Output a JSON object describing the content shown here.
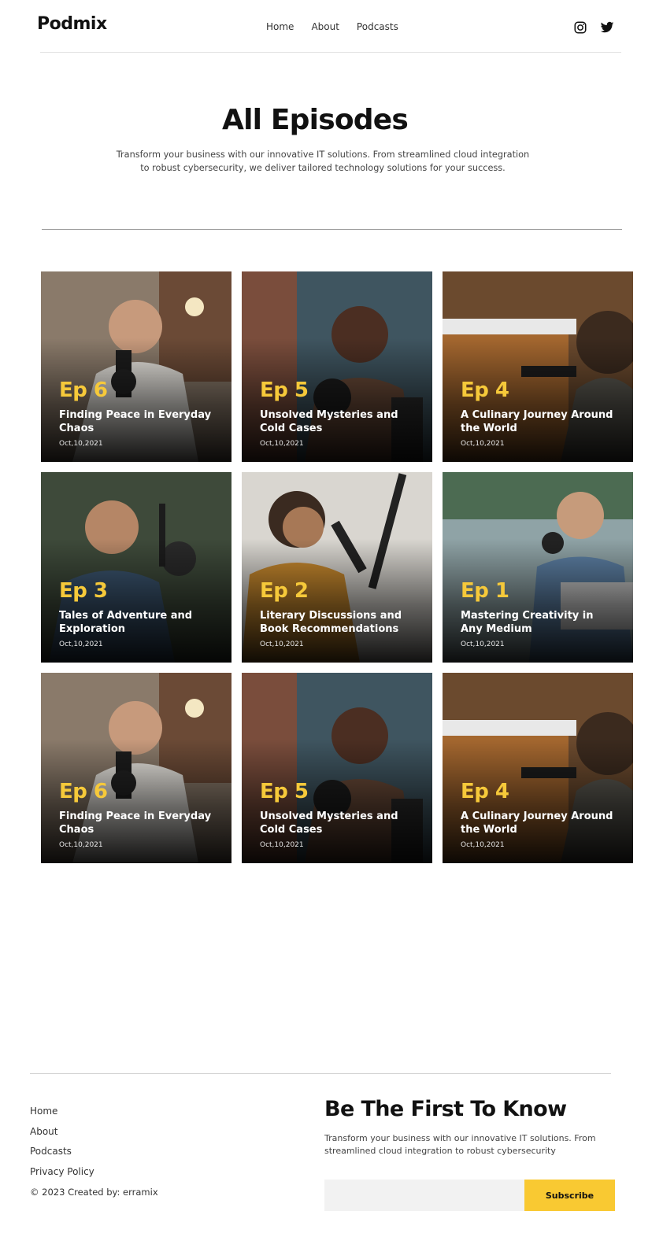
{
  "brand": {
    "name": "Podmix"
  },
  "nav": {
    "items": [
      "Home",
      "About",
      "Podcasts"
    ]
  },
  "social": {
    "icons": [
      "instagram-icon",
      "twitter-icon"
    ]
  },
  "hero": {
    "title": "All Episodes",
    "subtitle": "Transform your business with our innovative IT solutions. From streamlined cloud integration to robust cybersecurity, we deliver tailored technology solutions for your success."
  },
  "episodes": [
    {
      "ep": "Ep 6",
      "title": "Finding Peace in Everyday Chaos",
      "date": "Oct,10,2021"
    },
    {
      "ep": "Ep 5",
      "title": "Unsolved Mysteries and Cold Cases",
      "date": "Oct,10,2021"
    },
    {
      "ep": "Ep 4",
      "title": "A Culinary Journey Around the World",
      "date": "Oct,10,2021"
    },
    {
      "ep": "Ep 3",
      "title": "Tales of Adventure and Exploration",
      "date": "Oct,10,2021"
    },
    {
      "ep": "Ep 2",
      "title": "Literary Discussions and Book Recommendations",
      "date": "Oct,10,2021"
    },
    {
      "ep": "Ep 1",
      "title": "Mastering Creativity in Any Medium",
      "date": "Oct,10,2021"
    },
    {
      "ep": "Ep 6",
      "title": "Finding Peace in Everyday Chaos",
      "date": "Oct,10,2021"
    },
    {
      "ep": "Ep 5",
      "title": "Unsolved Mysteries and Cold Cases",
      "date": "Oct,10,2021"
    },
    {
      "ep": "Ep 4",
      "title": "A Culinary Journey Around the World",
      "date": "Oct,10,2021"
    }
  ],
  "footer": {
    "links": [
      "Home",
      "About",
      "Podcasts",
      "Privacy Policy"
    ],
    "copyright": "© 2023 Created by: erramix",
    "newsletter": {
      "title": "Be The First To Know",
      "text": "Transform your business with our innovative IT solutions. From streamlined cloud integration to robust cybersecurity",
      "placeholder": "",
      "button": "Subscribe"
    }
  },
  "colors": {
    "accent": "#f9c932",
    "episode_label": "#f6c93a",
    "text": "#111111"
  }
}
